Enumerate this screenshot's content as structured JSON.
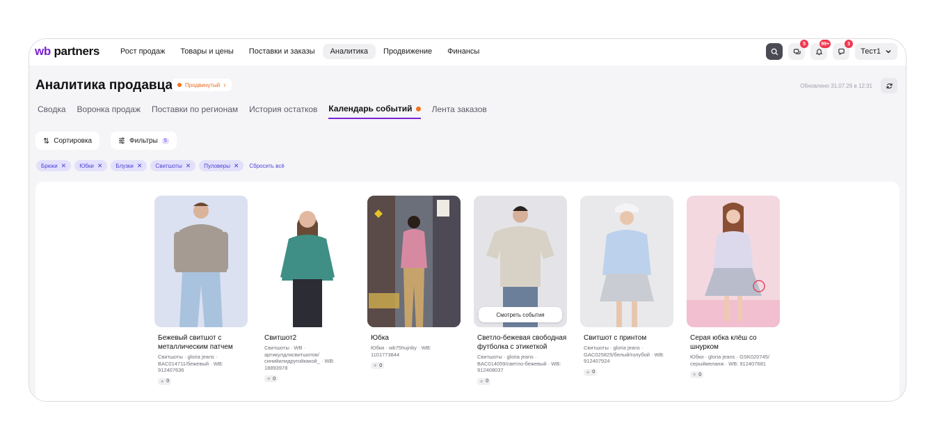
{
  "header": {
    "logo_wb": "wb",
    "logo_partners": "partners",
    "nav": [
      "Рост продаж",
      "Товары и цены",
      "Поставки и заказы",
      "Аналитика",
      "Продвижение",
      "Финансы"
    ],
    "active_nav": "Аналитика",
    "messages_badge": "5",
    "notifications_badge": "99+",
    "chat_badge": "3",
    "user_name": "Тест1"
  },
  "page": {
    "title": "Аналитика продавца",
    "plan_label": "Продвинутый",
    "updated": "Обновлено 31.07.26 в 12:31"
  },
  "tabs": [
    "Сводка",
    "Воронка продаж",
    "Поставки по регионам",
    "История остатков",
    "Календарь событий",
    "Лента заказов"
  ],
  "active_tab": "Календарь событий",
  "controls": {
    "sort_label": "Сортировка",
    "filters_label": "Фильтры",
    "filters_count": "5"
  },
  "chips": [
    "Брюки",
    "Юбки",
    "Блузки",
    "Свитшоты",
    "Пуловеры"
  ],
  "reset_label": "Сбросить всё",
  "view_events_label": "Смотреть события",
  "products": [
    {
      "title": "Бежевый свитшот с металлическим патчем",
      "meta": "Свитшоты · gloria jeans · BAC014711/бежевый · WB: 912407636",
      "rating": "0",
      "bg": "#dbe1f1"
    },
    {
      "title": "Свитшот2",
      "meta": "Свитшоты · WB · артикулдлясвитшотов/ синийилидругойкакой_ · WB: 18893978",
      "rating": "0",
      "bg": "#ffffff"
    },
    {
      "title": "Юбка",
      "meta": "Юбки · wb75hujnby · WB: 1101773844",
      "rating": "0",
      "bg": "#3c3a46"
    },
    {
      "title": "Светло-бежевая свободная футболка с этикеткой",
      "meta": "Свитшоты · gloria jeans · BAC014059/светло-бежевый · WB: 912408037",
      "rating": "0",
      "bg": "#e4e4e8"
    },
    {
      "title": "Свитшот с принтом",
      "meta": "Свитшоты · gloria jeans · GAC025825/белый/голубой · WB: 912407924",
      "rating": "0",
      "bg": "#e9e9ec"
    },
    {
      "title": "Серая юбка клёш со шнурком",
      "meta": "Юбки · gloria jeans · GSK020745/серыймеланж · WB: 912407681",
      "rating": "0",
      "bg": "#f3d8e0"
    }
  ]
}
